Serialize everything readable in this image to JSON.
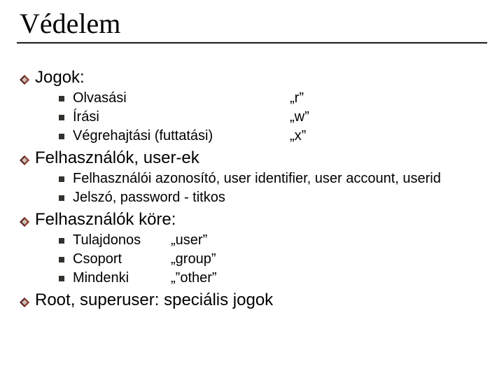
{
  "title": "Védelem",
  "sections": {
    "rights": {
      "heading": "Jogok:",
      "items": [
        {
          "label": "Olvasási",
          "value": "„r”"
        },
        {
          "label": "Írási",
          "value": "„w”"
        },
        {
          "label": "Végrehajtási (futtatási)",
          "value": "„x”"
        }
      ]
    },
    "users": {
      "heading": "Felhasználók, user-ek",
      "items": [
        {
          "text": "Felhasználói azonosító, user identifier, user account, userid"
        },
        {
          "text": "Jelszó, password - titkos"
        }
      ]
    },
    "scope": {
      "heading": "Felhasználók  köre:",
      "items": [
        {
          "label": "Tulajdonos",
          "value": "„user”"
        },
        {
          "label": "Csoport",
          "value": "„group”"
        },
        {
          "label": "Mindenki",
          "value": "„”other”"
        }
      ]
    },
    "root": {
      "heading": "Root, superuser: speciális jogok"
    }
  }
}
